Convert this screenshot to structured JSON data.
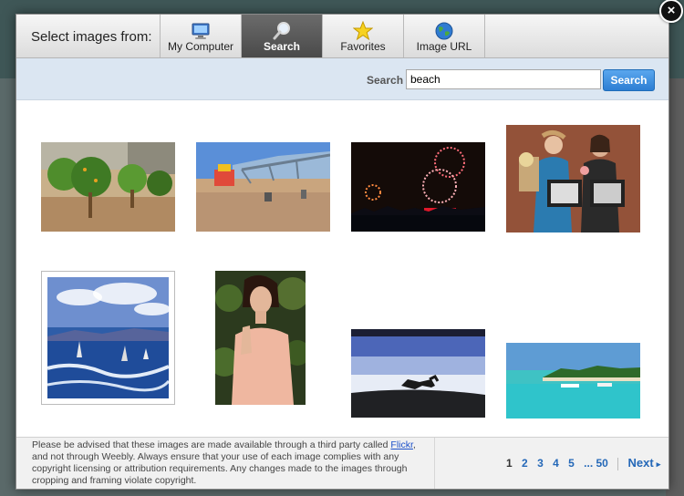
{
  "dialog": {
    "close_glyph": "×"
  },
  "tabs": {
    "prefix_label": "Select images from:",
    "items": [
      {
        "label": "My Computer",
        "icon": "computer-icon"
      },
      {
        "label": "Search",
        "icon": "magnifier-icon",
        "active": true
      },
      {
        "label": "Favorites",
        "icon": "star-icon"
      },
      {
        "label": "Image URL",
        "icon": "globe-icon"
      }
    ]
  },
  "search": {
    "label": "Search",
    "value": "beach",
    "button_label": "Search"
  },
  "results": [
    {
      "subject": "orange trees in an orchard"
    },
    {
      "subject": "beach playground with pier"
    },
    {
      "subject": "fireworks over a city at night"
    },
    {
      "subject": "two women holding framed pictures and flowers"
    },
    {
      "subject": "windsurfers at sea"
    },
    {
      "subject": "woman in peach dress among leaves"
    },
    {
      "subject": "dog running on a beach"
    },
    {
      "subject": "turquoise tropical beach with boats"
    }
  ],
  "footer": {
    "notice_before": "Please be advised that these images are made available through a third party called ",
    "notice_link": "Flickr",
    "notice_after": ", and not through Weebly. Always ensure that your use of each image complies with any copyright licensing or attribution requirements. Any changes made to the images through cropping and framing violate copyright.",
    "pages": [
      "1",
      "2",
      "3",
      "4",
      "5",
      "... 50"
    ],
    "current_page": "1",
    "next_label": "Next",
    "next_glyph": "▸"
  },
  "colors": {
    "active_tab": "#555555",
    "search_bar": "#dbe6f2",
    "primary_button": "#2d7ed3",
    "link": "#2468b8"
  }
}
